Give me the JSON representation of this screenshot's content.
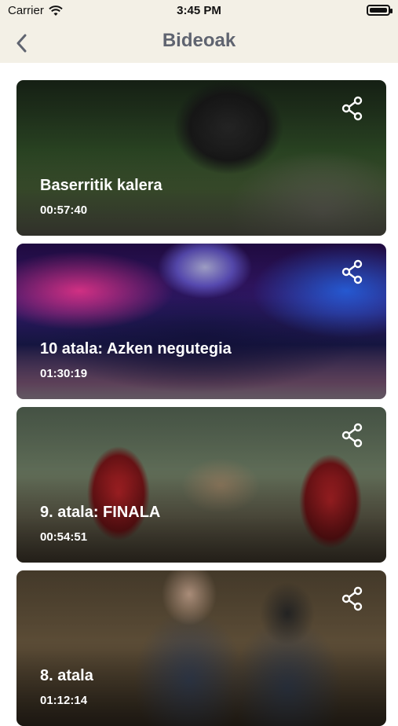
{
  "status": {
    "carrier": "Carrier",
    "time": "3:45 PM"
  },
  "nav": {
    "title": "Bideoak",
    "back_icon": "chevron-left-icon"
  },
  "videos": [
    {
      "title": "Baserritik kalera",
      "duration": "00:57:40"
    },
    {
      "title": "10 atala: Azken negutegia",
      "duration": "01:30:19"
    },
    {
      "title": "9. atala: FINALA",
      "duration": "00:54:51"
    },
    {
      "title": "8. atala",
      "duration": "01:12:14"
    }
  ],
  "icons": {
    "share": "share-icon",
    "wifi": "wifi-icon",
    "battery": "battery-icon"
  },
  "colors": {
    "nav_background": "#f3f0e6",
    "title_color": "#5f6470",
    "overlay_text": "#ffffff"
  }
}
